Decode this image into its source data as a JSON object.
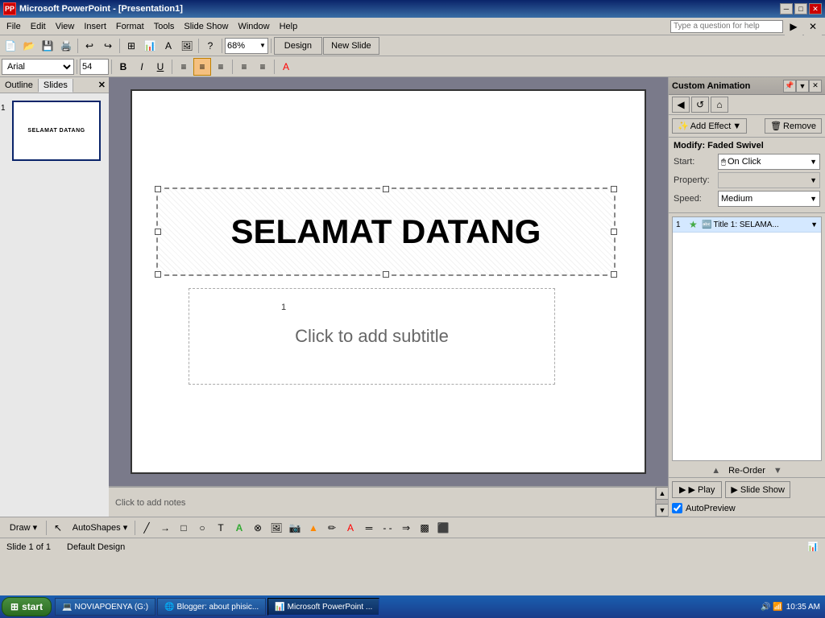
{
  "window": {
    "title": "Microsoft PowerPoint - [Presentation1]",
    "icon": "PP"
  },
  "titlebar": {
    "text": "Microsoft PowerPoint - [Presentation1]",
    "min_btn": "─",
    "max_btn": "□",
    "close_btn": "✕"
  },
  "menubar": {
    "items": [
      "File",
      "Edit",
      "View",
      "Insert",
      "Format",
      "Tools",
      "Slide Show",
      "Window",
      "Help"
    ]
  },
  "search": {
    "placeholder": "Type a question for help"
  },
  "toolbar1": {
    "zoom": "68%"
  },
  "toolbar2": {
    "font": "Arial",
    "fontsize": "54"
  },
  "tabs": {
    "outline": "Outline",
    "slides": "Slides"
  },
  "slide": {
    "title": "SELAMAT DATANG",
    "subtitle_placeholder": "Click to add subtitle",
    "notes_placeholder": "Click to add notes"
  },
  "slide_thumb": {
    "number": "1",
    "text": "SELAMAT DATANG"
  },
  "animation_panel": {
    "title": "Custom Animation",
    "add_effect_label": "Add Effect",
    "remove_label": "Remove",
    "modify_label": "Modify: Faded Swivel",
    "start_label": "Start:",
    "start_value": "On Click",
    "property_label": "Property:",
    "property_value": "",
    "speed_label": "Speed:",
    "speed_value": "Medium",
    "anim_item_num": "1",
    "anim_item_text": "Title 1: SELAMA...",
    "reorder_up": "Re-Order",
    "play_label": "▶ Play",
    "slideshow_label": "Slide Show",
    "autopreview_label": "AutoPreview"
  },
  "status_bar": {
    "slide_info": "Slide 1 of 1",
    "design": "Default Design"
  },
  "taskbar": {
    "start_label": "start",
    "items": [
      {
        "label": "NOVIAPOENYA (G:)",
        "active": false
      },
      {
        "label": "Blogger: about phisic...",
        "active": false
      },
      {
        "label": "Microsoft PowerPoint ...",
        "active": true
      }
    ],
    "time": "10:35 AM"
  },
  "draw_toolbar": {
    "draw_label": "Draw ▾",
    "autoshapes_label": "AutoShapes ▾"
  }
}
